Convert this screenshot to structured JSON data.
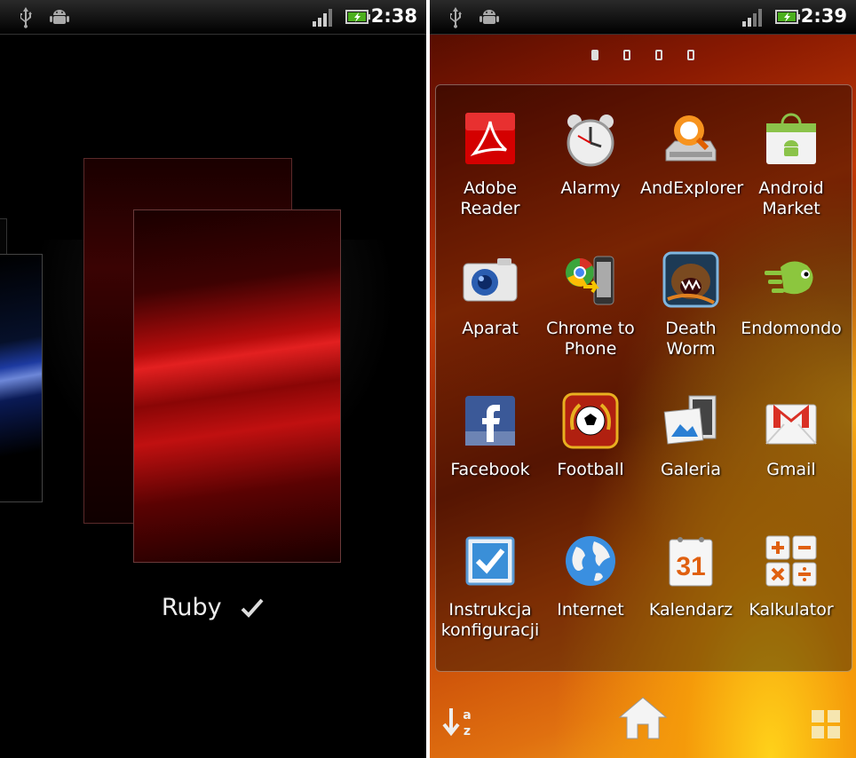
{
  "left_screen": {
    "status": {
      "time": "2:38"
    },
    "selected_theme": "Ruby"
  },
  "right_screen": {
    "status": {
      "time": "2:39"
    },
    "page_indicator": {
      "pages": 4,
      "active": 1
    },
    "apps": [
      {
        "label": "Adobe Reader",
        "icon": "adobe-reader-icon"
      },
      {
        "label": "Alarmy",
        "icon": "alarm-clock-icon"
      },
      {
        "label": "AndExplorer",
        "icon": "file-explorer-icon"
      },
      {
        "label": "Android Market",
        "icon": "android-market-icon"
      },
      {
        "label": "Aparat",
        "icon": "camera-icon"
      },
      {
        "label": "Chrome to Phone",
        "icon": "chrome-to-phone-icon"
      },
      {
        "label": "Death Worm",
        "icon": "death-worm-icon"
      },
      {
        "label": "Endomondo",
        "icon": "endomondo-icon"
      },
      {
        "label": "Facebook",
        "icon": "facebook-icon"
      },
      {
        "label": "Football",
        "icon": "football-icon"
      },
      {
        "label": "Galeria",
        "icon": "gallery-icon"
      },
      {
        "label": "Gmail",
        "icon": "gmail-icon"
      },
      {
        "label": "Instrukcja konfiguracji",
        "icon": "setup-guide-icon"
      },
      {
        "label": "Internet",
        "icon": "internet-globe-icon"
      },
      {
        "label": "Kalendarz",
        "icon": "calendar-icon",
        "badge": "31"
      },
      {
        "label": "Kalkulator",
        "icon": "calculator-icon"
      }
    ],
    "bottom_bar": {
      "sort_icon_text": "a z",
      "home_icon": "home-icon",
      "grid_icon": "grid-view-icon"
    }
  },
  "colors": {
    "accent_red": "#c01010",
    "status_green": "#4caf1e"
  }
}
